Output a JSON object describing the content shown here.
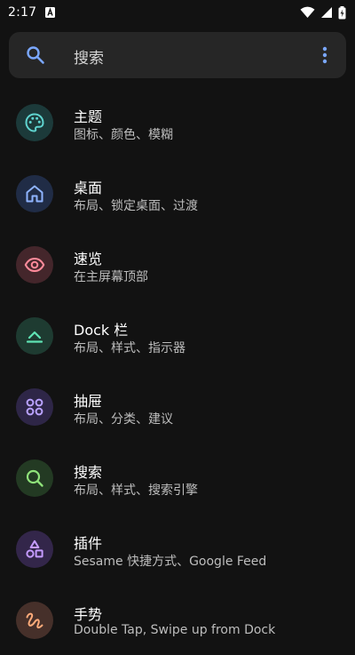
{
  "status_bar": {
    "time": "2:17",
    "notification_icon": "a-app-icon",
    "wifi_icon": "wifi-icon",
    "signal_icon": "signal-icon",
    "battery_icon": "battery-charging-icon"
  },
  "search": {
    "placeholder": "搜索",
    "icon": "search-icon",
    "menu_icon": "more-vert-icon",
    "accent": "#7aa7ff"
  },
  "settings": [
    {
      "title": "主题",
      "subtitle": "图标、颜色、模糊",
      "icon": "palette-icon",
      "color": "#5fd4cf",
      "bg": "#1c3a3a"
    },
    {
      "title": "桌面",
      "subtitle": "布局、锁定桌面、过渡",
      "icon": "home-icon",
      "color": "#8fb4ff",
      "bg": "#202c46"
    },
    {
      "title": "速览",
      "subtitle": "在主屏幕顶部",
      "icon": "eye-icon",
      "color": "#ff8a9a",
      "bg": "#44262b"
    },
    {
      "title": "Dock 栏",
      "subtitle": "布局、样式、指示器",
      "icon": "dock-icon",
      "color": "#5fe3b4",
      "bg": "#1e3b31"
    },
    {
      "title": "抽屉",
      "subtitle": "布局、分类、建议",
      "icon": "app-drawer-icon",
      "color": "#b9a2ff",
      "bg": "#2e2647"
    },
    {
      "title": "搜索",
      "subtitle": "布局、样式、搜索引擎",
      "icon": "search-icon",
      "color": "#8fe27a",
      "bg": "#233a23"
    },
    {
      "title": "插件",
      "subtitle": "Sesame 快捷方式、Google Feed",
      "icon": "shapes-icon",
      "color": "#c49bff",
      "bg": "#33264a"
    },
    {
      "title": "手势",
      "subtitle": "Double Tap, Swipe up from Dock",
      "icon": "gesture-icon",
      "color": "#ffab7a",
      "bg": "#46302a"
    }
  ]
}
